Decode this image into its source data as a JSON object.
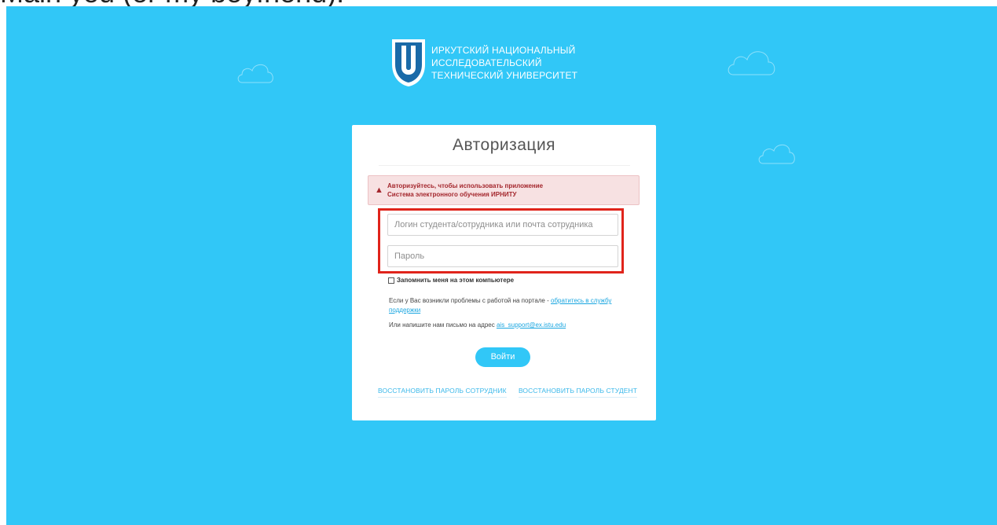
{
  "top_strip": {
    "text": "Main you (or my boyfriend)."
  },
  "logo": {
    "lines": [
      "ИРКУТСКИЙ НАЦИОНАЛЬНЫЙ",
      "ИССЛЕДОВАТЕЛЬСКИЙ",
      "ТЕХНИЧЕСКИЙ УНИВЕРСИТЕТ"
    ],
    "mark_letter": "U"
  },
  "card": {
    "title": "Авторизация",
    "alert": {
      "icon": "warning-icon",
      "line1": "Авторизуйтесь, чтобы использовать приложение",
      "line2": "Система электронного обучения ИРНИТУ"
    },
    "login_placeholder": "Логин студента/сотрудника или почта сотрудника",
    "password_placeholder": "Пароль",
    "remember_label": "Запомнить меня на этом компьютере",
    "help": {
      "text": "Если у Вас возникли проблемы с работой на портале - ",
      "link": "обратитесь в службу поддержки"
    },
    "mail": {
      "text": "Или напишите нам письмо на адрес ",
      "link": "ais_support@ex.istu.edu"
    },
    "login_button": "Войти",
    "restore_employee": "ВОССТАНОВИТЬ ПАРОЛЬ СОТРУДНИК",
    "restore_student": "ВОССТАНОВИТЬ ПАРОЛЬ СТУДЕНТ"
  },
  "colors": {
    "background": "#31c7f7",
    "alert_text": "#a4272d",
    "highlight": "#e0241b",
    "link": "#1aa6e0"
  }
}
